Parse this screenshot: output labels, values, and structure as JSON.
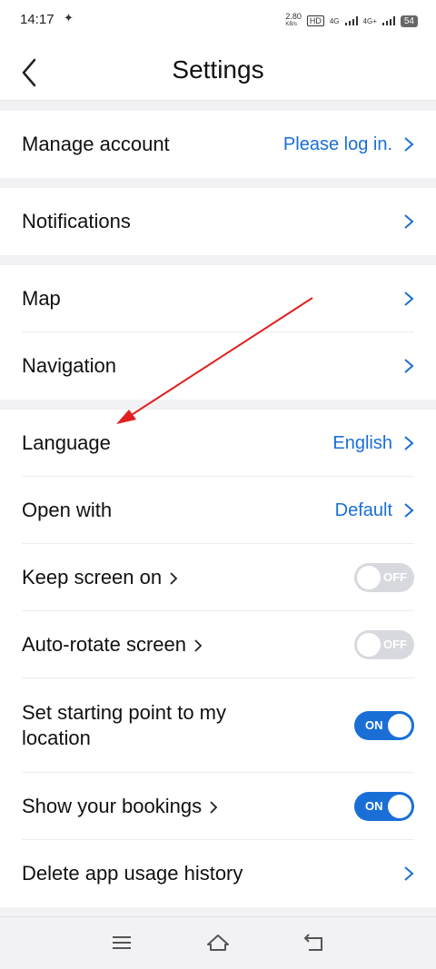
{
  "status_bar": {
    "time": "14:17",
    "net_speed": "2.80",
    "net_unit": "KB/s",
    "hd": "HD",
    "sim1": "4G",
    "sim2": "4G+",
    "battery": "54"
  },
  "header": {
    "title": "Settings"
  },
  "rows": {
    "manage_account": {
      "label": "Manage account",
      "value": "Please log in."
    },
    "notifications": {
      "label": "Notifications"
    },
    "map": {
      "label": "Map"
    },
    "navigation": {
      "label": "Navigation"
    },
    "language": {
      "label": "Language",
      "value": "English"
    },
    "open_with": {
      "label": "Open with",
      "value": "Default"
    },
    "keep_screen_on": {
      "label": "Keep screen on",
      "toggle": "OFF"
    },
    "auto_rotate": {
      "label": "Auto-rotate screen",
      "toggle": "OFF"
    },
    "starting_point": {
      "label": "Set starting point to my location",
      "toggle": "ON"
    },
    "bookings": {
      "label": "Show your bookings",
      "toggle": "ON"
    },
    "delete_history": {
      "label": "Delete app usage history"
    }
  },
  "colors": {
    "accent": "#1a6fd6",
    "annotation": "#e02020"
  }
}
